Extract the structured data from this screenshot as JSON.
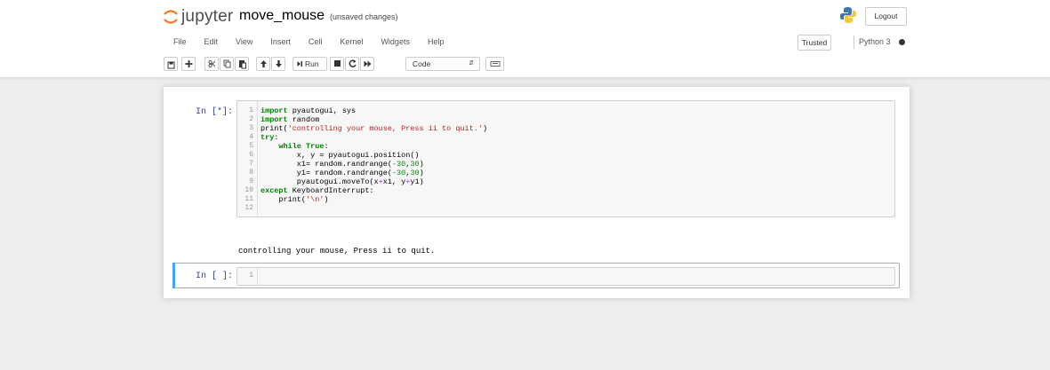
{
  "header": {
    "logo_text": "jupyter",
    "notebook_title": "move_mouse",
    "autosave_status": "(unsaved changes)",
    "logout_label": "Logout"
  },
  "menubar": {
    "items": [
      "File",
      "Edit",
      "View",
      "Insert",
      "Cell",
      "Kernel",
      "Widgets",
      "Help"
    ],
    "trusted_label": "Trusted",
    "kernel_name": "Python 3"
  },
  "toolbar": {
    "run_label": "Run",
    "cell_type": "Code",
    "icons": [
      "save-icon",
      "plus-icon",
      "cut-icon",
      "copy-icon",
      "paste-icon",
      "arrow-up-icon",
      "arrow-down-icon",
      "run-icon",
      "stop-icon",
      "restart-icon",
      "fast-forward-icon",
      "keyboard-icon"
    ]
  },
  "cells": [
    {
      "prompt": "In [*]:",
      "line_numbers": [
        "1",
        "2",
        "3",
        "4",
        "5",
        "6",
        "7",
        "8",
        "9",
        "10",
        "11",
        "12"
      ],
      "output": "controlling your mouse, Press ii to quit."
    },
    {
      "prompt": "In [ ]:",
      "line_numbers": [
        "1"
      ]
    }
  ],
  "code_lines": [
    "import pyautogui, sys",
    "import random",
    "print('controlling your mouse, Press ii to quit.')",
    "try:",
    "    while True:",
    "        x, y = pyautogui.position()",
    "        x1= random.randrange(-30,30)",
    "        y1= random.randrange(-30,30)",
    "        pyautogui.moveTo(x+x1, y+y1)",
    "except KeyboardInterrupt:",
    "    print('\\n')",
    ""
  ],
  "colors": {
    "prompt": "#303f9f",
    "selected_cell_bar": "#42a5f5",
    "logo_orange": "#f37726",
    "keyword": "#008000",
    "string": "#ba2121"
  }
}
